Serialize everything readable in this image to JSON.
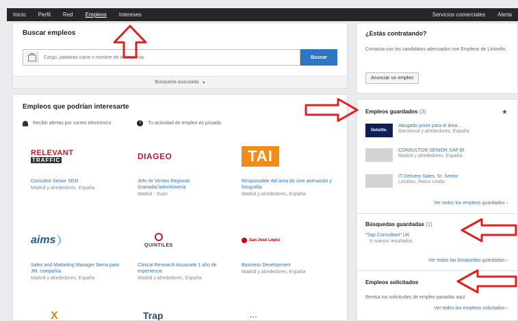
{
  "nav": {
    "items": [
      "Inicio",
      "Perfil",
      "Red",
      "Empleos",
      "Intereses"
    ],
    "active": "Empleos",
    "right_items": [
      "Servicios comerciales",
      "Alerta"
    ]
  },
  "search": {
    "title": "Buscar empleos",
    "placeholder": "Cargo, palabras clave o nombre de la empresa",
    "button": "Buscar",
    "advanced": "Búsqueda avanzada"
  },
  "jobs": {
    "title": "Empleos que podrían interesarte",
    "alerts_text": "Recibir alertas por correo electrónico",
    "privacy_text": "Tu actividad de empleo es privada",
    "cards": [
      {
        "logo": "RELEVANT TRAFFIC",
        "title": "Consultor Senior SEM",
        "location": "Madrid y alrededores, España"
      },
      {
        "logo": "DIAGEO",
        "title": "Jefe de Ventas Regional Granada/Jaén/Almería",
        "location": "Madrid - Suan"
      },
      {
        "logo": "TAI",
        "title": "Responsable del área de cine animación y fotografía",
        "location": "Madrid y alrededores, España"
      },
      {
        "logo": "aims",
        "title": "Sales and Marketing Manager Iberia para JM. compañía",
        "location": "Madrid y alrededores, España"
      },
      {
        "logo": "QUINTILES",
        "title": "Clinical Research Associate 1 año de experiencia",
        "location": "Madrid y alrededores, España"
      },
      {
        "logo": "San José López",
        "title": "Business Development",
        "location": "Madrid y alrededores, España"
      }
    ],
    "bottom_logos": [
      "X",
      "Trap",
      "…"
    ]
  },
  "hiring": {
    "title": "¿Estás contratando?",
    "text": "Contacta con los candidatos adecuados con Empleos de LinkedIn.",
    "button": "Anunciar un empleo"
  },
  "saved": {
    "title": "Empleos guardados",
    "count": "(3)",
    "items": [
      {
        "thumb": "Deloitte.",
        "title": "Abogado junior para el área…",
        "location": "Barcelona y alrededores, España"
      },
      {
        "thumb": "",
        "title": "CONSULTOR SENIOR SAP BI",
        "location": "Madrid y alrededores, España"
      },
      {
        "thumb": "",
        "title": "IT Delivery Sales, Sr. Senior",
        "location": "Londres, Reino Unido"
      }
    ],
    "more": "Ver todos los empleos guardados ›"
  },
  "searches": {
    "title": "Búsquedas guardadas",
    "count": "(1)",
    "query": "\"Sap Consultant\" UK",
    "results": "9 nuevos resultados",
    "more": "Ver todas las búsquedas guardadas ›"
  },
  "applied": {
    "title": "Empleos solicitados",
    "text": "Revisa tus solicitudes de empleo pasadas aquí",
    "more": "Ver todos los empleos solicitados ›"
  },
  "colors": {
    "nav_bg": "#262626",
    "accent": "#2a78c2",
    "link": "#3574b8",
    "arrow": "#e02020"
  }
}
